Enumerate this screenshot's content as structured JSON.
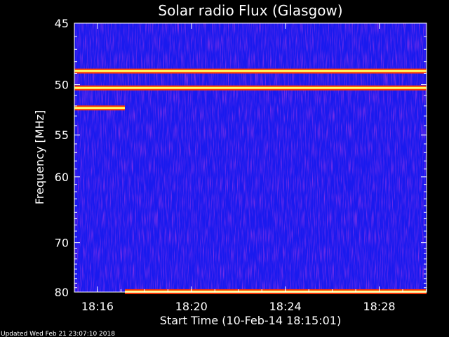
{
  "chart_data": {
    "type": "heatmap",
    "title": "Solar radio Flux (Glasgow)",
    "xlabel": "Start Time (10-Feb-14 18:15:01)",
    "ylabel": "Frequency [MHz]",
    "x_unit": "minutes",
    "x_range": [
      "18:15:01",
      "18:30:01"
    ],
    "x_ticks": [
      "18:16",
      "18:20",
      "18:24",
      "18:28"
    ],
    "x_tick_values": [
      "18:16",
      "18:20",
      "18:24",
      "18:28"
    ],
    "y_scale": "reciprocal",
    "ylim": [
      45,
      80
    ],
    "y_ticks": [
      45,
      50,
      55,
      60,
      70,
      80
    ],
    "grid": false,
    "colors": {
      "background": "#1a1aee",
      "intense": "#ffff66",
      "medium": "#ff3300",
      "faint": "#8a1fb0"
    },
    "features": [
      {
        "type": "interference-band",
        "frequency_mhz": 48.8,
        "time_range": [
          "18:15:01",
          "18:30:01"
        ]
      },
      {
        "type": "interference-band",
        "frequency_mhz": 50.3,
        "time_range": [
          "18:15:01",
          "18:30:01"
        ]
      },
      {
        "type": "interference-band",
        "frequency_mhz": 52.2,
        "time_range": [
          "18:15:01",
          "18:17:10"
        ]
      },
      {
        "type": "interference-band",
        "frequency_mhz": 79.9,
        "time_range": [
          "18:17:10",
          "18:30:01"
        ]
      }
    ]
  },
  "footer": {
    "updated": "Updated Wed Feb 21 23:07:10 2018"
  }
}
